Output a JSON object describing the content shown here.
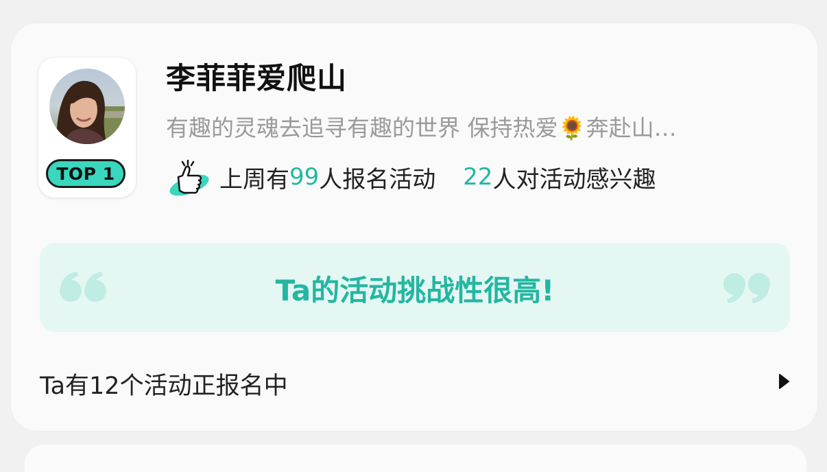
{
  "profile": {
    "name": "李菲菲爱爬山",
    "bio": "有趣的灵魂去追寻有趣的世界 保持热爱🌻奔赴山…",
    "badge": "TOP 1",
    "avatar_icon": "user-avatar-photo"
  },
  "stats": {
    "icon": "thumbs-up-icon",
    "prefix": "上周有",
    "signup_count": "99",
    "signup_suffix": "人报名活动",
    "interest_count": "22",
    "interest_suffix": "人对活动感兴趣"
  },
  "quote": {
    "text": "Ta的活动挑战性很高!",
    "left_icon": "open-quote-icon",
    "right_icon": "close-quote-icon"
  },
  "activities": {
    "label": "Ta有12个活动正报名中",
    "arrow_icon": "play-arrow-icon"
  },
  "colors": {
    "accent": "#23b7a2",
    "badge": "#3ad6bd",
    "quote_bg": "#e5f7f3"
  }
}
